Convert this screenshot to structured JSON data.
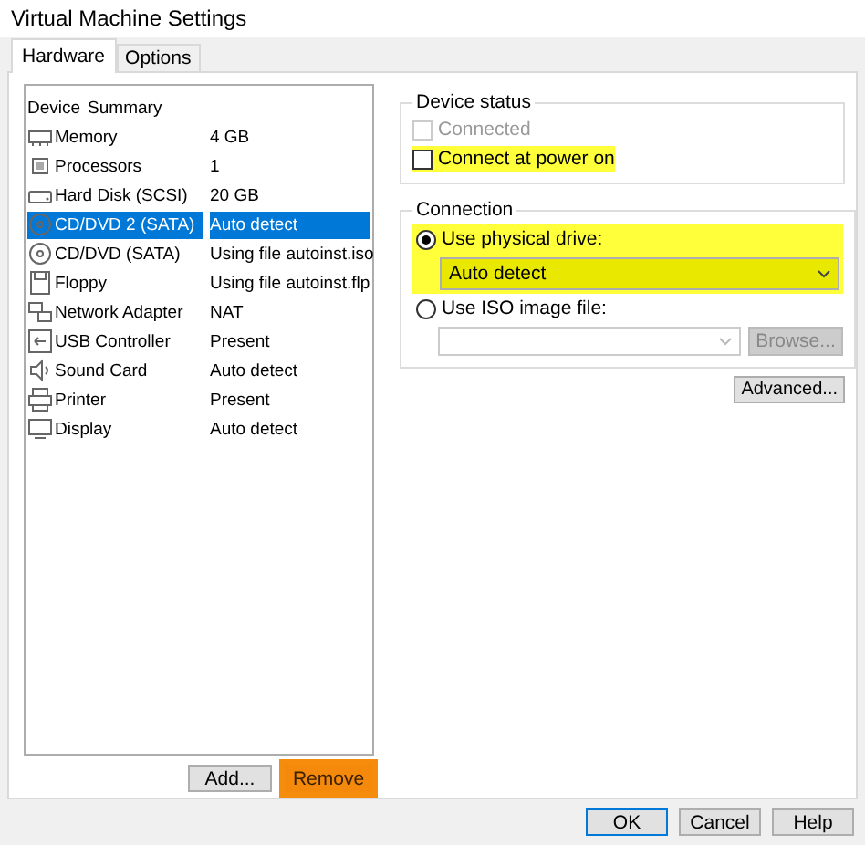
{
  "window": {
    "title": "Virtual Machine Settings"
  },
  "tabs": [
    {
      "label": "Hardware",
      "selected": true
    },
    {
      "label": "Options",
      "selected": false
    }
  ],
  "device_list": {
    "columns": [
      "Device",
      "Summary"
    ],
    "rows": [
      {
        "kind": "memory",
        "device": "Memory",
        "summary": "4 GB",
        "selected": false
      },
      {
        "kind": "cpu",
        "device": "Processors",
        "summary": "1",
        "selected": false
      },
      {
        "kind": "disk",
        "device": "Hard Disk (SCSI)",
        "summary": "20 GB",
        "selected": false
      },
      {
        "kind": "cd",
        "device": "CD/DVD 2 (SATA)",
        "summary": "Auto detect",
        "selected": true
      },
      {
        "kind": "cd",
        "device": "CD/DVD (SATA)",
        "summary": "Using file autoinst.iso",
        "selected": false
      },
      {
        "kind": "floppy",
        "device": "Floppy",
        "summary": "Using file autoinst.flp",
        "selected": false
      },
      {
        "kind": "network",
        "device": "Network Adapter",
        "summary": "NAT",
        "selected": false
      },
      {
        "kind": "usb",
        "device": "USB Controller",
        "summary": "Present",
        "selected": false
      },
      {
        "kind": "sound",
        "device": "Sound Card",
        "summary": "Auto detect",
        "selected": false
      },
      {
        "kind": "printer",
        "device": "Printer",
        "summary": "Present",
        "selected": false
      },
      {
        "kind": "display",
        "device": "Display",
        "summary": "Auto detect",
        "selected": false
      }
    ]
  },
  "list_buttons": [
    {
      "label": "Add...",
      "highlighted": false
    },
    {
      "label": "Remove",
      "highlighted": true
    }
  ],
  "device_status": {
    "title": "Device status",
    "checkboxes": [
      {
        "label": "Connected",
        "checked": false,
        "disabled": true,
        "highlighted": false
      },
      {
        "label": "Connect at power on",
        "checked": false,
        "disabled": false,
        "highlighted": true
      }
    ]
  },
  "connection": {
    "title": "Connection",
    "physical_drive": {
      "label": "Use physical drive:",
      "selected": true,
      "highlighted": true,
      "value": "Auto detect"
    },
    "iso_image": {
      "label": "Use ISO image file:",
      "selected": false,
      "browse": "Browse..."
    }
  },
  "advanced_button": "Advanced...",
  "dialog_buttons": [
    "OK",
    "Cancel",
    "Help"
  ]
}
